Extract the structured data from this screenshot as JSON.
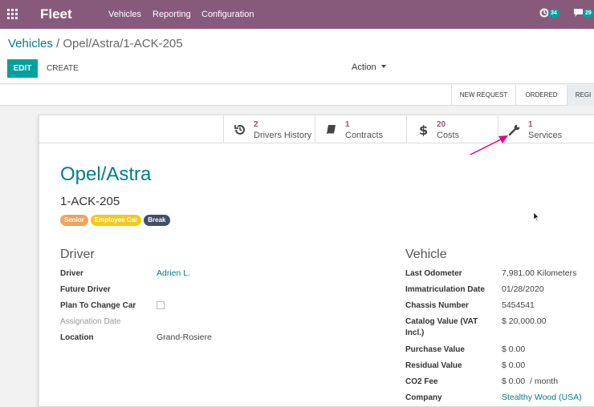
{
  "navbar": {
    "brand": "Fleet",
    "menu": [
      "Vehicles",
      "Reporting",
      "Configuration"
    ],
    "activity_badge": "34",
    "messages_badge": "29"
  },
  "breadcrumb": {
    "parent": "Vehicles",
    "separator": "/",
    "current": "Opel/Astra/1-ACK-205"
  },
  "buttons": {
    "edit": "EDIT",
    "create": "CREATE",
    "action": "Action"
  },
  "stages": [
    "NEW REQUEST",
    "ORDERED",
    "REGI"
  ],
  "smart_buttons": [
    {
      "value": "2",
      "label": "Drivers History",
      "icon": "history-icon"
    },
    {
      "value": "1",
      "label": "Contracts",
      "icon": "book-icon"
    },
    {
      "value": "20",
      "label": "Costs",
      "icon": "dollar-icon"
    },
    {
      "value": "1",
      "label": "Services",
      "icon": "wrench-icon"
    }
  ],
  "vehicle": {
    "model": "Opel/Astra",
    "plate": "1-ACK-205",
    "tags": [
      {
        "label": "Senior",
        "color": "#f0a35a"
      },
      {
        "label": "Employee Car",
        "color": "#f3cb16"
      },
      {
        "label": "Break",
        "color": "#444e6b"
      }
    ]
  },
  "driver_section": {
    "title": "Driver",
    "fields": [
      {
        "label": "Driver",
        "value": "Adrien L."
      },
      {
        "label": "Future Driver",
        "value": ""
      },
      {
        "label": "Plan To Change Car",
        "value": ""
      },
      {
        "label": "Assignation Date",
        "value": ""
      },
      {
        "label": "Location",
        "value": "Grand-Rosiere"
      }
    ]
  },
  "vehicle_section": {
    "title": "Vehicle",
    "fields": [
      {
        "label": "Last Odometer",
        "value": "7,981.00",
        "extra": "Kilometers"
      },
      {
        "label": "Immatriculation Date",
        "value": "01/28/2020"
      },
      {
        "label": "Chassis Number",
        "value": "5454541"
      },
      {
        "label": "Catalog Value (VAT Incl.)",
        "value": "$ 20,000.00"
      },
      {
        "label": "Purchase Value",
        "value": "$ 0.00"
      },
      {
        "label": "Residual Value",
        "value": "$ 0.00"
      },
      {
        "label": "CO2 Fee",
        "value": "$ 0.00",
        "extra": "/ month"
      },
      {
        "label": "Company",
        "value": "Stealthy Wood (USA)"
      }
    ]
  },
  "colors": {
    "navbar": "#875a7b",
    "primary": "#00a09d",
    "link": "#017e84",
    "annotation": "#e6007e"
  }
}
